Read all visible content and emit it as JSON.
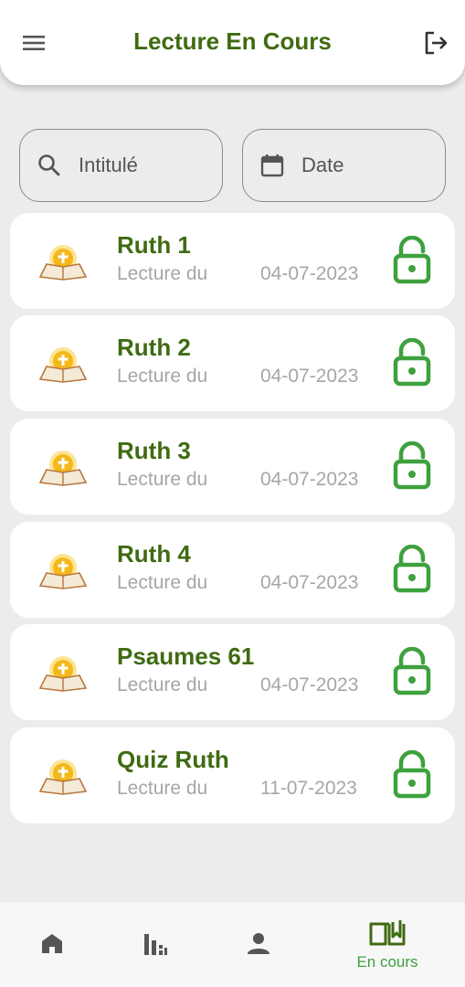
{
  "header": {
    "title": "Lecture En Cours",
    "menu_icon": "menu-icon",
    "logout_icon": "logout-icon"
  },
  "filters": {
    "search_placeholder": "Intitulé",
    "search_icon": "search-icon",
    "date_placeholder": "Date",
    "date_icon": "calendar-icon"
  },
  "readings": [
    {
      "title": "Ruth 1",
      "label": "Lecture du",
      "date": "04-07-2023",
      "status_icon": "lock-open-icon"
    },
    {
      "title": "Ruth 2",
      "label": "Lecture du",
      "date": "04-07-2023",
      "status_icon": "lock-open-icon"
    },
    {
      "title": "Ruth 3",
      "label": "Lecture du",
      "date": "04-07-2023",
      "status_icon": "lock-open-icon"
    },
    {
      "title": "Ruth 4",
      "label": "Lecture du",
      "date": "04-07-2023",
      "status_icon": "lock-open-icon"
    },
    {
      "title": "Psaumes 61",
      "label": "Lecture du",
      "date": "04-07-2023",
      "status_icon": "lock-open-icon"
    },
    {
      "title": "Quiz Ruth",
      "label": "Lecture du",
      "date": "11-07-2023",
      "status_icon": "lock-open-icon"
    }
  ],
  "bottom_nav": {
    "items": [
      {
        "icon": "home-icon",
        "label": ""
      },
      {
        "icon": "stats-icon",
        "label": ""
      },
      {
        "icon": "person-icon",
        "label": ""
      },
      {
        "icon": "open-book-icon",
        "label": "En cours",
        "active": true
      }
    ]
  },
  "colors": {
    "primary_text": "#3f6b12",
    "accent_green": "#3ea13e",
    "muted_text": "#a6a6a6",
    "background": "#ececec"
  }
}
